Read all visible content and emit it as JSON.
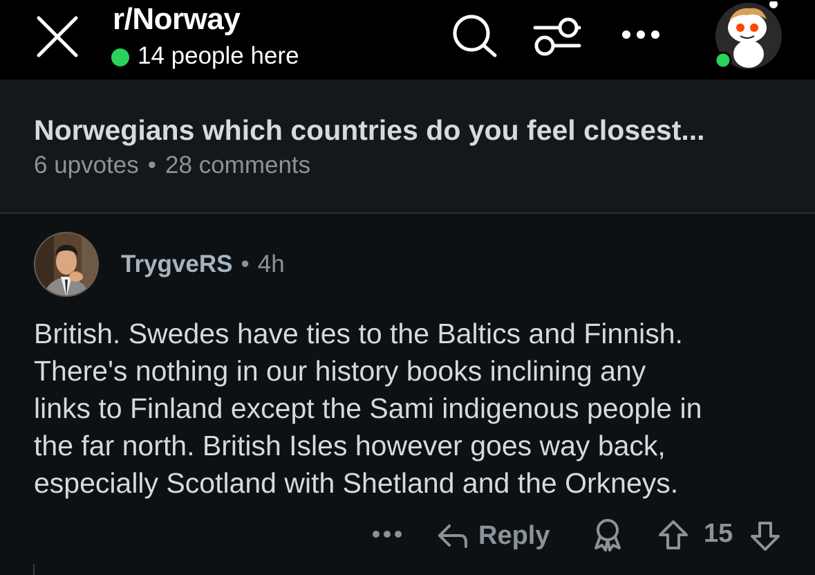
{
  "header": {
    "subreddit": "r/Norway",
    "online_text": "14 people here",
    "online_color": "#2bd25a",
    "icons": [
      "close-icon",
      "search-icon",
      "filter-icon",
      "more-icon",
      "user-avatar-icon"
    ]
  },
  "post": {
    "title": "Norwegians which countries do you feel closest...",
    "upvotes": "6 upvotes",
    "separator": "•",
    "comments": "28 comments"
  },
  "comment": {
    "author": "TrygveRS",
    "separator": "•",
    "age": "4h",
    "lines": [
      "British. Swedes have ties to the Baltics and Finnish.",
      "There's nothing in our history books inclining any",
      "links to Finland except the Sami indigenous people in",
      "the far north. British Isles however goes way back,",
      "especially Scotland with Shetland and the Orkneys."
    ],
    "actions": {
      "more_icon": "more-dots-icon",
      "reply_label": "Reply",
      "award_icon": "award-icon",
      "upvote_icon": "upvote-arrow-icon",
      "score": "15",
      "downvote_icon": "downvote-arrow-icon"
    }
  },
  "colors": {
    "background": "#0e1113",
    "header_bg": "#000000",
    "post_bar_bg": "#15181b",
    "text": "#d7dadc",
    "muted": "#8a9399",
    "author": "#a6b4bf"
  }
}
